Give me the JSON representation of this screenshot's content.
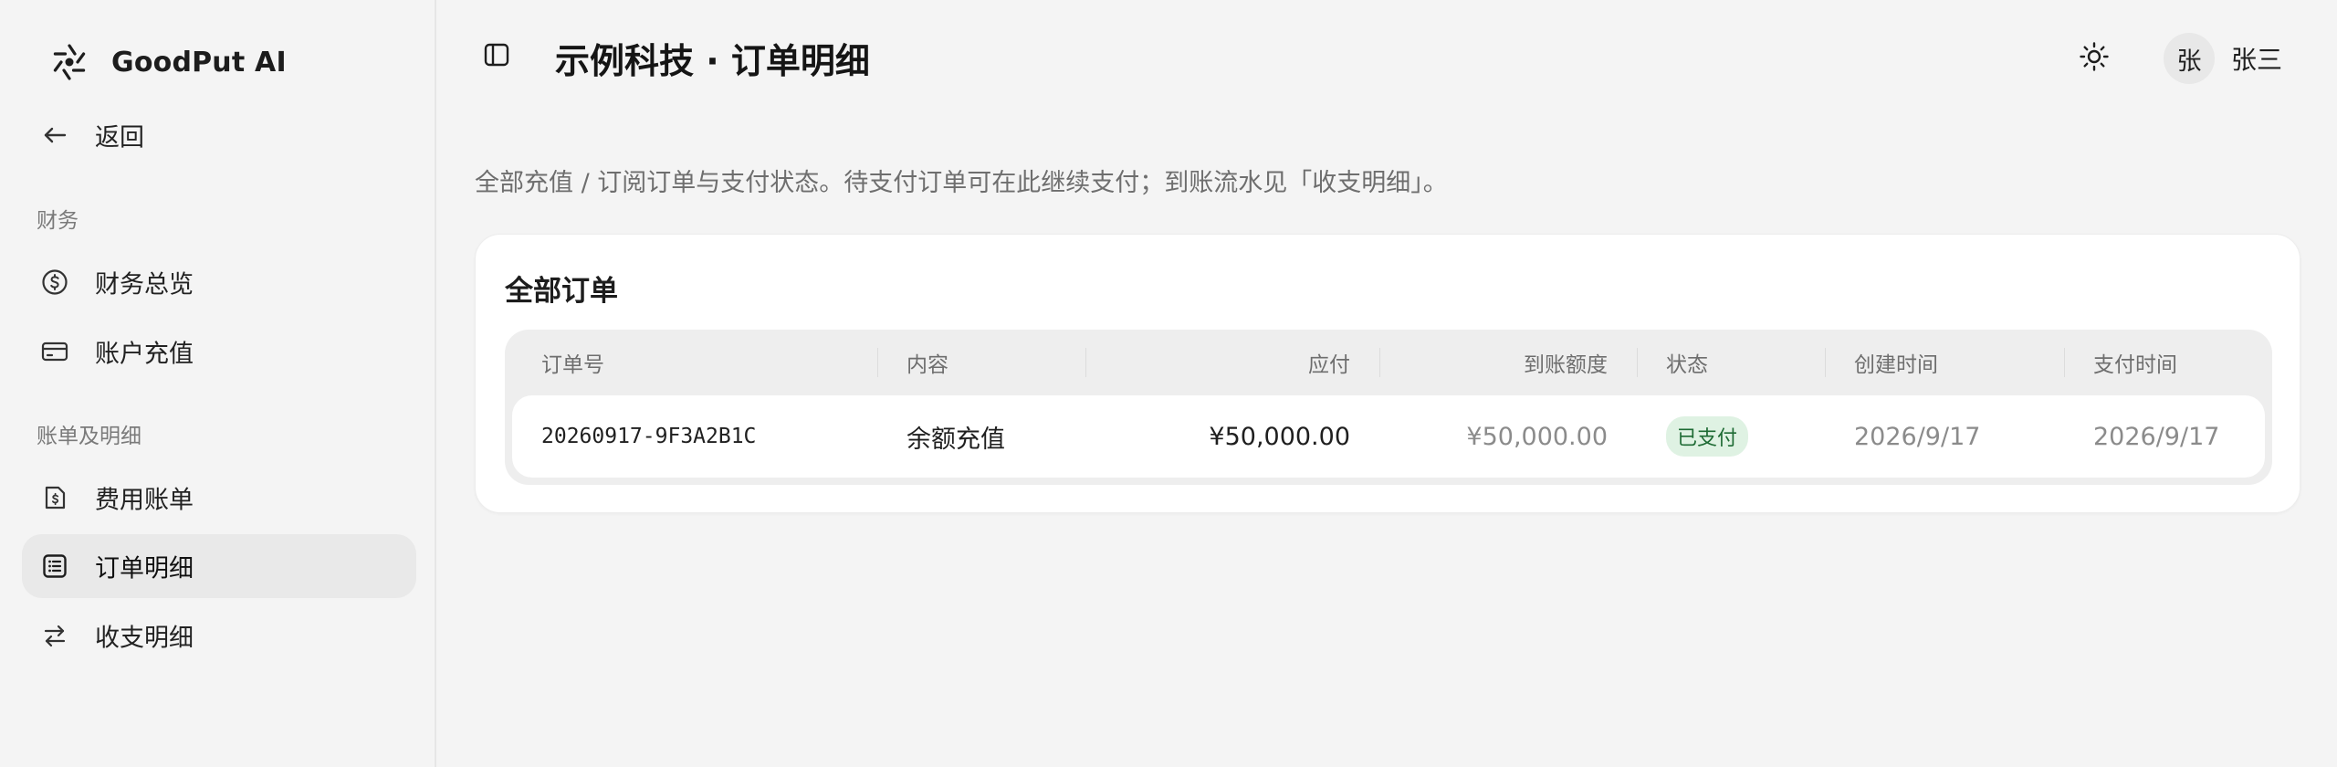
{
  "brand": {
    "name": "GoodPut AI",
    "logo_icon": "aperture-icon"
  },
  "sidebar": {
    "back_label": "返回",
    "sections": [
      {
        "title": "财务",
        "items": [
          {
            "label": "财务总览",
            "icon": "dollar-circle-icon",
            "active": false
          },
          {
            "label": "账户充值",
            "icon": "credit-card-icon",
            "active": false
          }
        ]
      },
      {
        "title": "账单及明细",
        "items": [
          {
            "label": "费用账单",
            "icon": "receipt-dollar-icon",
            "active": false
          },
          {
            "label": "订单明细",
            "icon": "list-icon",
            "active": true
          },
          {
            "label": "收支明细",
            "icon": "swap-arrows-icon",
            "active": false
          }
        ]
      }
    ]
  },
  "header": {
    "title": "示例科技 · 订单明细",
    "theme_icon": "sun-icon",
    "avatar_text": "张",
    "user_name": "张三"
  },
  "main": {
    "description": "全部充值 / 订阅订单与支付状态。待支付订单可在此继续支付；到账流水见「收支明细」。",
    "card_title": "全部订单",
    "table": {
      "columns": [
        "订单号",
        "内容",
        "应付",
        "到账额度",
        "状态",
        "创建时间",
        "支付时间"
      ],
      "rows": [
        {
          "order_no": "20260917-9F3A2B1C",
          "content": "余额充值",
          "payable": "¥50,000.00",
          "credited": "¥50,000.00",
          "status": "已支付",
          "created": "2026/9/17",
          "paid": "2026/9/17"
        }
      ]
    }
  },
  "colors": {
    "background": "#f4f4f4",
    "active_item": "#e9e9e9",
    "status_paid_bg": "#dff2e3",
    "status_paid_text": "#1e6b34"
  }
}
